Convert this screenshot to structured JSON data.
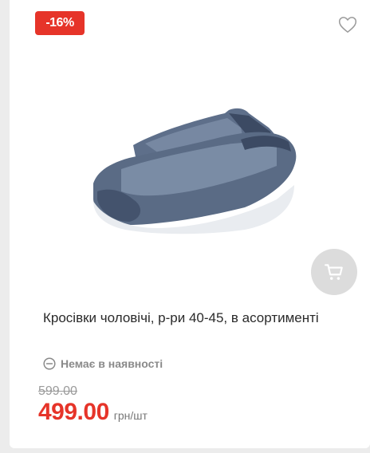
{
  "badge": {
    "discount": "-16%"
  },
  "product": {
    "title": "Кросівки чоловічі, р-ри 40-45, в асортименті",
    "stock_status": "Немає в наявності",
    "old_price": "599.00",
    "price": "499.00",
    "unit": "грн/шт"
  },
  "icons": {
    "favorite": "heart-icon",
    "cart": "cart-icon",
    "stock": "minus-circle-icon"
  },
  "colors": {
    "accent": "#e63429",
    "muted": "#8a8a8a"
  }
}
